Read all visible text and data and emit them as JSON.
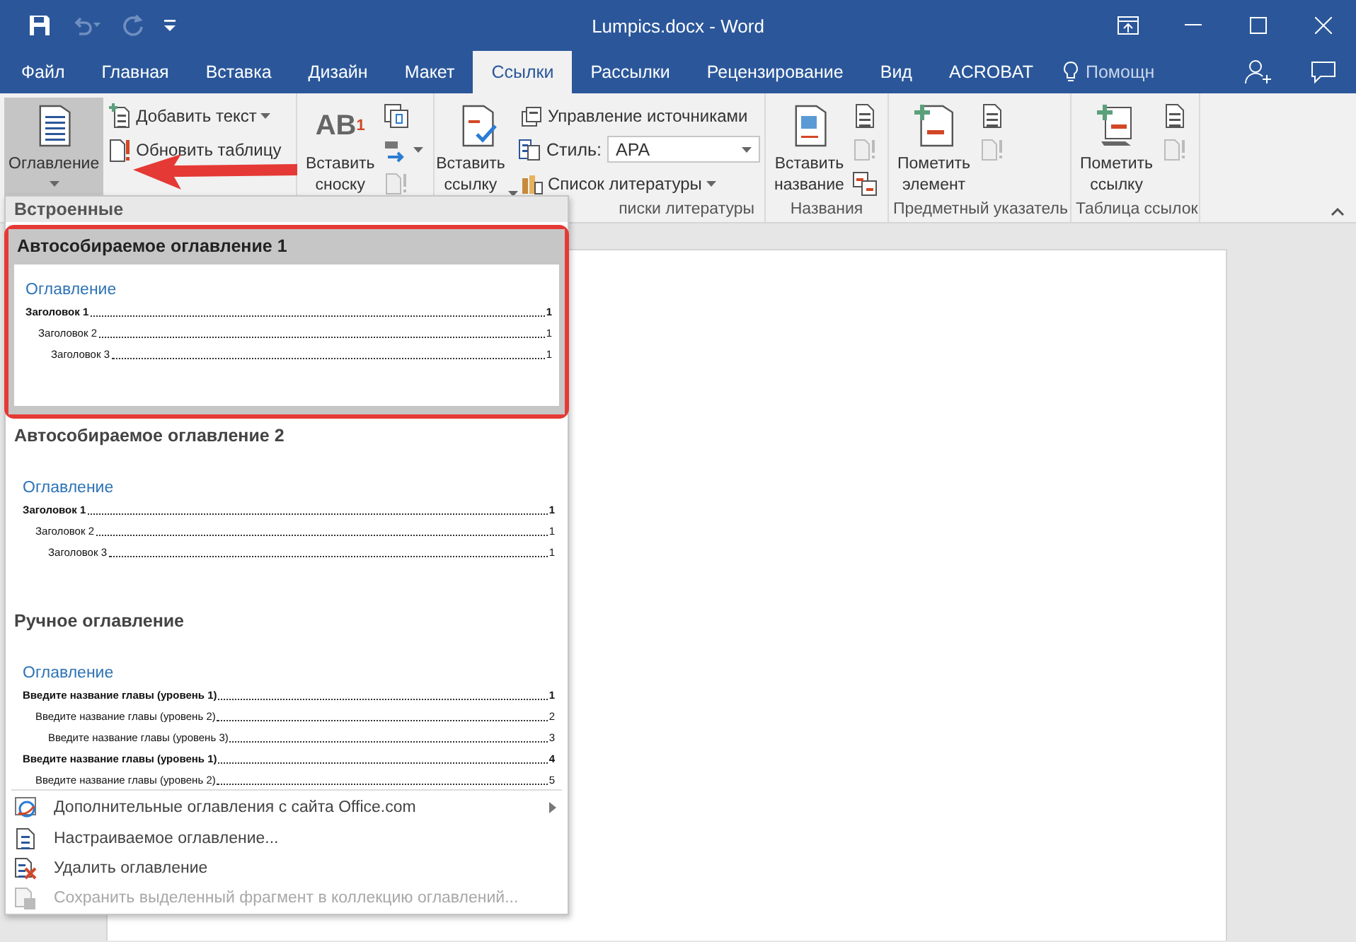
{
  "window": {
    "title": "Lumpics.docx - Word"
  },
  "tabs": [
    {
      "label": "Файл",
      "selected": false
    },
    {
      "label": "Главная",
      "selected": false
    },
    {
      "label": "Вставка",
      "selected": false
    },
    {
      "label": "Дизайн",
      "selected": false
    },
    {
      "label": "Макет",
      "selected": false
    },
    {
      "label": "Ссылки",
      "selected": true
    },
    {
      "label": "Рассылки",
      "selected": false
    },
    {
      "label": "Рецензирование",
      "selected": false
    },
    {
      "label": "Вид",
      "selected": false
    },
    {
      "label": "ACROBAT",
      "selected": false
    }
  ],
  "help": {
    "placeholder": "Помощн"
  },
  "ribbon": {
    "groups": [
      {
        "items": [
          {
            "kind": "large",
            "label": "Оглавление",
            "dropdown": true,
            "pressed": true
          },
          {
            "kind": "small",
            "label": "Добавить текст",
            "dropdown": true
          },
          {
            "kind": "small",
            "label": "Обновить таблицу"
          }
        ]
      },
      {
        "items": [
          {
            "kind": "large",
            "label": "Вставить сноску",
            "glyph": "AB",
            "glyph_sup": "1",
            "pressed": false
          },
          {
            "kind": "icon",
            "disabled": false
          },
          {
            "kind": "icon",
            "disabled": false,
            "dropdown": true
          },
          {
            "kind": "icon",
            "disabled": true
          }
        ]
      },
      {
        "label": "писки литературы",
        "items": [
          {
            "kind": "large",
            "label": "Вставить ссылку",
            "dropdown": true,
            "pressed": false
          },
          {
            "kind": "small",
            "label": "Управление источниками"
          },
          {
            "kind": "combo",
            "label": "Стиль:",
            "value": "APA"
          },
          {
            "kind": "small",
            "label": "Список литературы",
            "dropdown": true
          }
        ]
      },
      {
        "label": "Названия",
        "items": [
          {
            "kind": "large",
            "label": "Вставить название",
            "pressed": false
          },
          {
            "kind": "icon",
            "disabled": false
          },
          {
            "kind": "icon",
            "disabled": true
          },
          {
            "kind": "icon",
            "disabled": false
          }
        ]
      },
      {
        "label": "Предметный указатель",
        "items": [
          {
            "kind": "large",
            "label": "Пометить элемент",
            "pressed": false
          },
          {
            "kind": "icon",
            "disabled": false
          },
          {
            "kind": "icon",
            "disabled": true
          }
        ]
      },
      {
        "label": "Таблица ссылок",
        "items": [
          {
            "kind": "large",
            "label": "Пометить ссылку",
            "pressed": false
          },
          {
            "kind": "icon",
            "disabled": false
          },
          {
            "kind": "icon",
            "disabled": true
          }
        ]
      }
    ]
  },
  "toc_menu": {
    "section": "Встроенные",
    "gallery": [
      {
        "title": "Автособираемое оглавление 1",
        "selected": true,
        "preview": {
          "heading": "Оглавление",
          "entries": [
            {
              "text": "Заголовок 1",
              "page": "1",
              "children": [
                {
                  "text": "Заголовок 2",
                  "page": "1",
                  "children": [
                    {
                      "text": "Заголовок 3",
                      "page": "1"
                    }
                  ]
                }
              ]
            }
          ]
        }
      },
      {
        "title": "Автособираемое оглавление 2",
        "selected": false,
        "preview": {
          "heading": "Оглавление",
          "entries": [
            {
              "text": "Заголовок 1",
              "page": "1",
              "children": [
                {
                  "text": "Заголовок 2",
                  "page": "1",
                  "children": [
                    {
                      "text": "Заголовок 3",
                      "page": "1"
                    }
                  ]
                }
              ]
            }
          ]
        }
      },
      {
        "title": "Ручное оглавление",
        "selected": false,
        "preview": {
          "heading": "Оглавление",
          "entries": [
            {
              "text": "Введите название главы (уровень 1)",
              "page": "1",
              "children": [
                {
                  "text": "Введите название главы (уровень 2)",
                  "page": "2",
                  "children": [
                    {
                      "text": "Введите название главы (уровень 3)",
                      "page": "3"
                    }
                  ]
                }
              ]
            },
            {
              "text": "Введите название главы (уровень 1)",
              "page": "4",
              "children": [
                {
                  "text": "Введите название главы (уровень 2)",
                  "page": "5"
                }
              ]
            }
          ]
        }
      }
    ],
    "commands": [
      {
        "label": "Дополнительные оглавления с сайта Office.com",
        "disabled": false,
        "submenu": true
      },
      {
        "label": "Настраиваемое оглавление...",
        "disabled": false,
        "submenu": false
      },
      {
        "label": "Удалить оглавление",
        "disabled": false,
        "submenu": false
      },
      {
        "label": "Сохранить выделенный фрагмент в коллекцию оглавлений...",
        "disabled": true,
        "submenu": false
      }
    ]
  }
}
